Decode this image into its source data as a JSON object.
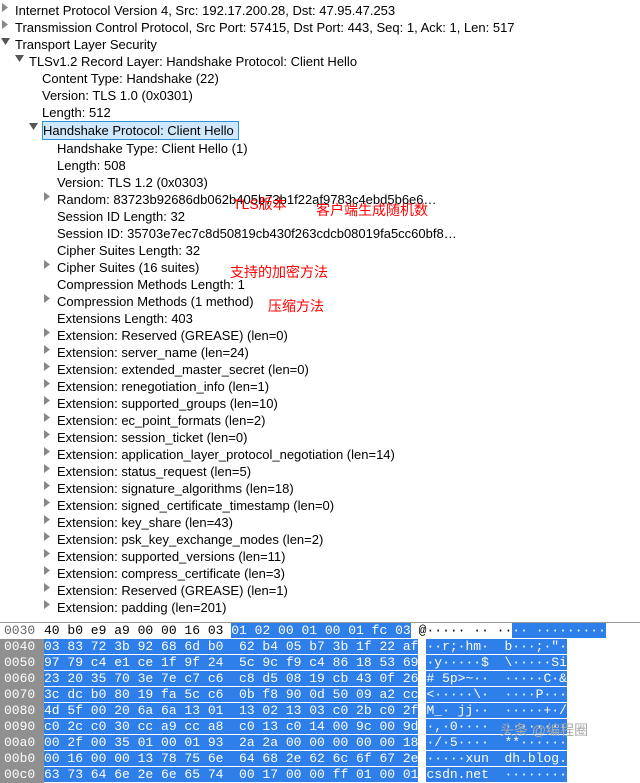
{
  "tree": {
    "top": [
      "Internet Protocol Version 4, Src: 192.17.200.28, Dst: 47.95.47.253",
      "Transmission Control Protocol, Src Port: 57415, Dst Port: 443, Seq: 1, Ack: 1, Len: 517",
      "Transport Layer Security"
    ],
    "record": "TLSv1.2 Record Layer: Handshake Protocol: Client Hello",
    "record_children": [
      "Content Type: Handshake (22)",
      "Version: TLS 1.0 (0x0301)",
      "Length: 512"
    ],
    "handshake": "Handshake Protocol: Client Hello",
    "handshake_children": [
      {
        "t": "Handshake Type: Client Hello (1)",
        "arrow": false
      },
      {
        "t": "Length: 508",
        "arrow": false
      },
      {
        "t": "Version: TLS 1.2 (0x0303)",
        "arrow": false
      },
      {
        "t": "Random: 83723b92686db062b405b73b1f22af9783c4ebd5b6e6…",
        "arrow": true
      },
      {
        "t": "Session ID Length: 32",
        "arrow": false
      },
      {
        "t": "Session ID: 35703e7ec7c8d50819cb430f263cdcb08019fa5cc60bf8…",
        "arrow": false
      },
      {
        "t": "Cipher Suites Length: 32",
        "arrow": false
      },
      {
        "t": "Cipher Suites (16 suites)",
        "arrow": true
      },
      {
        "t": "Compression Methods Length: 1",
        "arrow": false
      },
      {
        "t": "Compression Methods (1 method)",
        "arrow": true
      },
      {
        "t": "Extensions Length: 403",
        "arrow": false
      },
      {
        "t": "Extension: Reserved (GREASE) (len=0)",
        "arrow": true
      },
      {
        "t": "Extension: server_name (len=24)",
        "arrow": true
      },
      {
        "t": "Extension: extended_master_secret (len=0)",
        "arrow": true
      },
      {
        "t": "Extension: renegotiation_info (len=1)",
        "arrow": true
      },
      {
        "t": "Extension: supported_groups (len=10)",
        "arrow": true
      },
      {
        "t": "Extension: ec_point_formats (len=2)",
        "arrow": true
      },
      {
        "t": "Extension: session_ticket (len=0)",
        "arrow": true
      },
      {
        "t": "Extension: application_layer_protocol_negotiation (len=14)",
        "arrow": true
      },
      {
        "t": "Extension: status_request (len=5)",
        "arrow": true
      },
      {
        "t": "Extension: signature_algorithms (len=18)",
        "arrow": true
      },
      {
        "t": "Extension: signed_certificate_timestamp (len=0)",
        "arrow": true
      },
      {
        "t": "Extension: key_share (len=43)",
        "arrow": true
      },
      {
        "t": "Extension: psk_key_exchange_modes (len=2)",
        "arrow": true
      },
      {
        "t": "Extension: supported_versions (len=11)",
        "arrow": true
      },
      {
        "t": "Extension: compress_certificate (len=3)",
        "arrow": true
      },
      {
        "t": "Extension: Reserved (GREASE) (len=1)",
        "arrow": true
      },
      {
        "t": "Extension: padding (len=201)",
        "arrow": true
      }
    ]
  },
  "annotations": {
    "a1": "TLS版本",
    "a2": "客户端生成随机数",
    "a3": "支持的加密方法",
    "a4": "压缩方法"
  },
  "hex": [
    {
      "off": "0030",
      "b1": "40 b0 e9 a9 00 00 16 03 ",
      "b2": "01 02 00 ",
      "b3": "01 00 01 fc 03",
      "a1": "@····· ·· ··",
      "a2": "·· ·········",
      "plain": true
    },
    {
      "off": "0040",
      "b1": "",
      "b2": "03 83 72 3b 92 68 6d b0  62 b4 05 b7 3b 1f 22 af",
      "b3": "",
      "a1": "",
      "a2": "··r;·hm·  b···;·\"·"
    },
    {
      "off": "0050",
      "b1": "",
      "b2": "97 79 c4 e1 ce 1f 9f 24  5c 9c f9 c4 86 18 53 69",
      "b3": "",
      "a1": "",
      "a2": "·y·····$  \\·····Si"
    },
    {
      "off": "0060",
      "b1": "",
      "b2": "23 20 35 70 3e 7e c7 c6  c8 d5 08 19 cb 43 0f 26",
      "b3": "",
      "a1": "",
      "a2": "# 5p>~··  ·····C·&"
    },
    {
      "off": "0070",
      "b1": "",
      "b2": "3c dc b0 80 19 fa 5c c6  0b f8 90 0d 50 09 a2 cc",
      "b3": "",
      "a1": "",
      "a2": "<·····\\·  ····P···"
    },
    {
      "off": "0080",
      "b1": "",
      "b2": "4d 5f 00 20 6a 6a 13 01  13 02 13 03 c0 2b c0 2f",
      "b3": "",
      "a1": "",
      "a2": "M_· jj··  ·····+·/"
    },
    {
      "off": "0090",
      "b1": "",
      "b2": "c0 2c c0 30 cc a9 cc a8  c0 13 c0 14 00 9c 00 9d",
      "b3": "",
      "a1": "",
      "a2": "·,·0····  ········"
    },
    {
      "off": "00a0",
      "b1": "",
      "b2": "00 2f 00 35 01 00 01 93  2a 2a 00 00 00 00 00 18",
      "b3": "",
      "a1": "",
      "a2": "·/·5····  **······"
    },
    {
      "off": "00b0",
      "b1": "",
      "b2": "00 16 00 00 13 78 75 6e  64 68 2e 62 6c 6f 67 2e",
      "b3": "",
      "a1": "",
      "a2": "·····xun  dh.blog."
    },
    {
      "off": "00c0",
      "b1": "",
      "b2": "63 73 64 6e 2e 6e 65 74  00 17 00 00 ff 01 00 01",
      "b3": "",
      "a1": "",
      "a2": "csdn.net  ········"
    }
  ],
  "watermark": "头条 @编程圈"
}
